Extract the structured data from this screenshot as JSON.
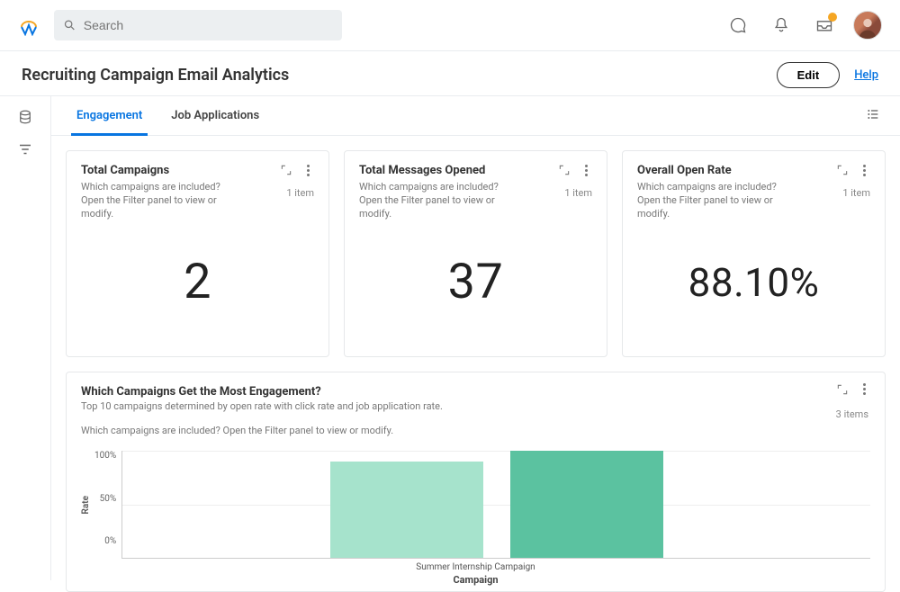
{
  "header": {
    "search_placeholder": "Search"
  },
  "page": {
    "title": "Recruiting Campaign Email Analytics",
    "edit_label": "Edit",
    "help_label": "Help"
  },
  "tabs": [
    {
      "label": "Engagement",
      "active": true
    },
    {
      "label": "Job Applications",
      "active": false
    }
  ],
  "cards": [
    {
      "title": "Total Campaigns",
      "subtitle": "Which campaigns are included? Open the Filter panel to view or modify.",
      "items": "1 item",
      "value": "2"
    },
    {
      "title": "Total Messages Opened",
      "subtitle": "Which campaigns are included? Open the Filter panel to view or modify.",
      "items": "1 item",
      "value": "37"
    },
    {
      "title": "Overall Open Rate",
      "subtitle": "Which campaigns are included? Open the Filter panel to view or modify.",
      "items": "1 item",
      "value": "88.10%"
    }
  ],
  "chart": {
    "title": "Which Campaigns Get the Most Engagement?",
    "desc": "Top 10 campaigns determined by open rate with click rate and job application rate.",
    "filter_note": "Which campaigns are included? Open the Filter panel to view or modify.",
    "items": "3 items",
    "ylabel": "Rate",
    "xlabel": "Campaign",
    "yticks": [
      "100%",
      "50%",
      "0%"
    ],
    "visible_category_label": "Summer Internship Campaign"
  },
  "chart_data": {
    "type": "bar",
    "categories": [
      "",
      "Summer Internship Campaign"
    ],
    "values": [
      90,
      100
    ],
    "colors": [
      "#a6e3cc",
      "#5bc2a0"
    ],
    "ylim": [
      0,
      100
    ],
    "ylabel": "Rate",
    "xlabel": "Campaign",
    "yticks": [
      0,
      50,
      100
    ],
    "yticklabels": [
      "0%",
      "50%",
      "100%"
    ],
    "title": "Which Campaigns Get the Most Engagement?"
  }
}
